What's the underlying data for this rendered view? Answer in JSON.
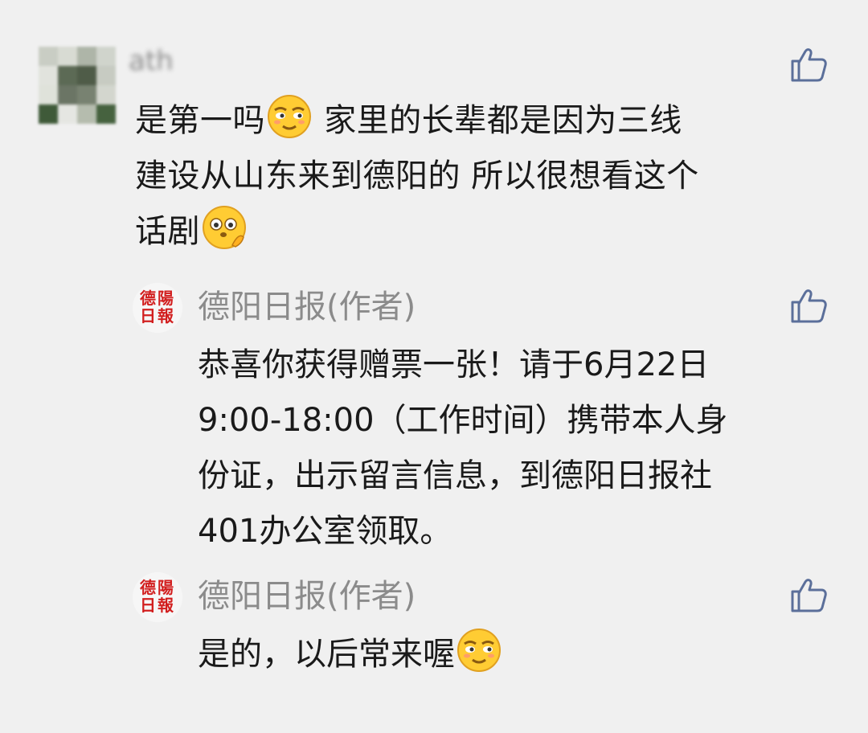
{
  "comment": {
    "user_name": "ath",
    "text_lines": [
      {
        "before": "是第一吗",
        "emoji": "smirk-emoji",
        "after": " 家里的长辈都是因为三线"
      },
      {
        "before": "建设从山东来到德阳的 所以很想看这个",
        "emoji": "",
        "after": ""
      },
      {
        "before": "话剧",
        "emoji": "peek-emoji",
        "after": ""
      }
    ],
    "like_icon": "thumbs-up-icon"
  },
  "replies": [
    {
      "author_logo": [
        "德陽",
        "日報"
      ],
      "author_name": "德阳日报(作者)",
      "text_lines": [
        {
          "before": "恭喜你获得赠票一张！请于6月22日",
          "emoji": "",
          "after": ""
        },
        {
          "before": "9:00-18:00（工作时间）携带本人身",
          "emoji": "",
          "after": ""
        },
        {
          "before": "份证，出示留言信息，到德阳日报社",
          "emoji": "",
          "after": ""
        },
        {
          "before": "401办公室领取。",
          "emoji": "",
          "after": ""
        }
      ],
      "like_icon": "thumbs-up-icon"
    },
    {
      "author_logo": [
        "德陽",
        "日報"
      ],
      "author_name": "德阳日报(作者)",
      "text_lines": [
        {
          "before": "是的，以后常来喔",
          "emoji": "smirk-emoji",
          "after": ""
        }
      ],
      "like_icon": "thumbs-up-icon"
    }
  ],
  "colors": {
    "background": "#f0f0f0",
    "text": "#1a1a1a",
    "author_name": "#8b8b8b",
    "like_icon": "#5b6f9a",
    "logo_red": "#d21f1f"
  }
}
